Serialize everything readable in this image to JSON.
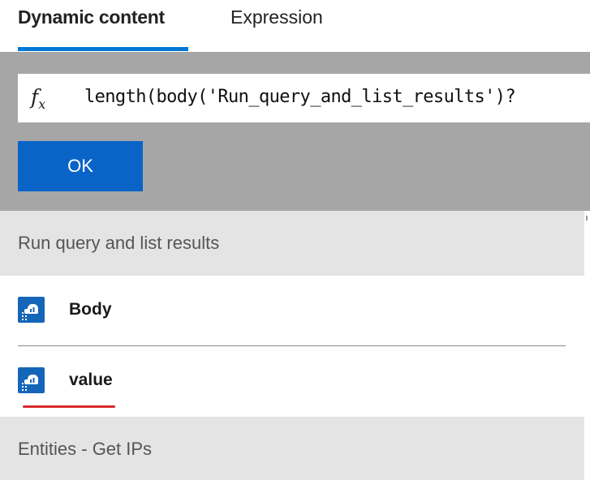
{
  "tabs": {
    "dynamic_content": "Dynamic content",
    "expression": "Expression"
  },
  "expression_editor": {
    "fx": "f",
    "fx_sub": "x",
    "value": "length(body('Run_query_and_list_results')?"
  },
  "ok_button": {
    "label": "OK"
  },
  "sections": [
    {
      "title": "Run query and list results",
      "items": [
        {
          "label": "Body",
          "icon": "sentinel-icon"
        },
        {
          "label": "value",
          "icon": "sentinel-icon"
        }
      ]
    },
    {
      "title": "Entities - Get IPs"
    }
  ],
  "colors": {
    "accent": "#0078d4",
    "ok_button": "#0a64c8",
    "icon_bg": "#1466b8",
    "highlight_underline": "#d62a2a",
    "panel_gray": "#a6a6a6",
    "section_gray": "#e4e4e4"
  }
}
